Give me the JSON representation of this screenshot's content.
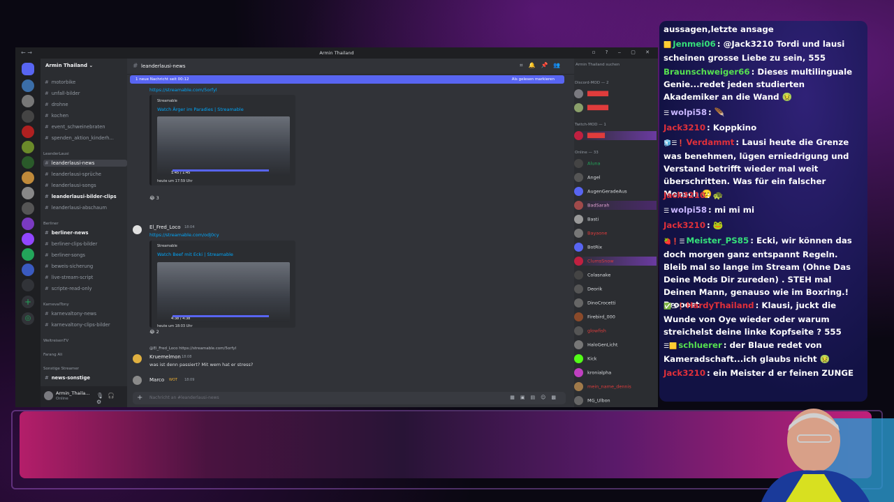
{
  "window": {
    "title": "Armin Thailand",
    "nav": "← →",
    "controls": "▫ ? ‒ ▢ ✕"
  },
  "guild": {
    "name": "Armin Thailand ⌄"
  },
  "channels": [
    {
      "label": "motorbike"
    },
    {
      "label": "unfall-bilder"
    },
    {
      "label": "drohne"
    },
    {
      "label": "kochen"
    },
    {
      "label": "event_schweinebraten"
    },
    {
      "label": "spenden_aktion_kinderh..."
    },
    {
      "label": "leanderlausi-news"
    },
    {
      "label": "leanderlausi-sprüche"
    },
    {
      "label": "leanderlausi-songs"
    },
    {
      "label": "leanderlausi-bilder-clips"
    },
    {
      "label": "leanderlausi-abschaum"
    },
    {
      "label": "berliner-news"
    },
    {
      "label": "berliner-clips-bilder"
    },
    {
      "label": "berliner-songs"
    },
    {
      "label": "beweis-sicherung"
    },
    {
      "label": "live-stream-script"
    },
    {
      "label": "scripte-read-only"
    },
    {
      "label": "karnevaltony-news"
    },
    {
      "label": "karnevaltony-clips-bilder"
    },
    {
      "label": "news-sonstige"
    }
  ],
  "categories": {
    "leanderlausi": "LeanderLausi",
    "berliner": "Berliner",
    "karneval": "KarnevalTony",
    "weltreisen": "WeltreisenTV",
    "farang": "Farang Ali",
    "sonstige": "Sonstige Streamer"
  },
  "user_panel": {
    "name": "Armin_Thaila...",
    "status": "Online"
  },
  "chat": {
    "channel": "leanderlausi-news",
    "new_message_text": "1 neue Nachricht seit 00:12",
    "mark_read": "Als gelesen markieren",
    "search_placeholder": "Armin Thailand suchen",
    "composer_placeholder": "Nachricht an #leanderlausi-news",
    "messages": [
      {
        "link": "https://streamable.com/5orfyl",
        "provider": "Streamable",
        "embed_title": "Watch Ärger im Paradies | Streamable",
        "time": "1:45 / 1:45",
        "footer": "heute um 17:59 Uhr",
        "reaction_count": "3"
      },
      {
        "author": "El_Fred_Loco",
        "timestamp": "18:04",
        "link": "https://streamable.com/odj0cy",
        "provider": "Streamable",
        "embed_title": "Watch Beef mit Ecki | Streamable",
        "time": "4:38 / 4:38",
        "footer": "heute um 18:03 Uhr",
        "reaction_count": "2"
      },
      {
        "reply": "@El_Fred_Loco https://streamable.com/5orfyl",
        "author": "Kruemelmon",
        "timestamp": "18:08",
        "text": "was ist denn passiert? Mit wem hat er stress?"
      },
      {
        "author": "Marco",
        "badge": "WOT",
        "timestamp": "18:09"
      }
    ]
  },
  "members": {
    "cat_mod": "Discord-MOD — 2",
    "cat_twitch": "Twitch-MOD — 1",
    "cat_online": "Online — 33",
    "list": [
      "Aluna",
      "Angel",
      "AugenGeradeAus",
      "BadSarah",
      "Basti",
      "Bayaone",
      "BotRix",
      "ClumsSnow",
      "Colasnake",
      "Deorik",
      "DinoCrocetti",
      "Firebird_000",
      "glowfish",
      "HaloGenLicht",
      "Kick",
      "kronialpha",
      "mein_name_dennis",
      "MG_Ulbon"
    ],
    "sub": {
      "BadSarah": "World of Warcraft",
      "Basti": "Arena Reforger",
      "Kick": "Sent 3232 notifications today. Off..."
    }
  },
  "twitch_chat": [
    {
      "name": "",
      "text": "aussagen,letzte ansage",
      "color": "#ffffff"
    },
    {
      "badges": "🟨",
      "name": "Jenmei06",
      "text": ": @Jack3210 Tordi und lausi scheinen grosse Liebe zu sein, 555",
      "color": "#36e07a"
    },
    {
      "name": "Braunschweiger66",
      "text": ": Dieses multilinguale Genie...redet jeden studierten Akademiker an die Wand 🤢",
      "color": "#56e050"
    },
    {
      "badges": "☰",
      "name": "wolpi58",
      "text": ": 🪶",
      "color": "#c9b7ff"
    },
    {
      "name": "Jack3210",
      "text": ": Koppkino",
      "color": "#e0303a"
    },
    {
      "badges": "🧊☰❗",
      "name": "Verdammt",
      "text": ": Lausi heute die Grenze was benehmen, lügen erniedrigung und Verstand betrifft wieder mal weit überschritten. Was für ein falscher Mensch 🫤",
      "color": "#e0303a"
    },
    {
      "name": "Jack3210",
      "text": ": 🐢",
      "color": "#e0303a"
    },
    {
      "badges": "☰",
      "name": "wolpi58",
      "text": ": mi mi mi",
      "color": "#c9b7ff"
    },
    {
      "name": "Jack3210",
      "text": ": 🐸",
      "color": "#e0303a"
    },
    {
      "badges": "🍓❗☰",
      "name": "Meister_PS85",
      "text": ": Ecki, wir können das doch morgen ganz entspannt Regeln. Bleib mal so lange im Stream (Ohne Das Deine Mods Dir zureden) . STEH mal Deinen Mann, genauso wie im Boxring.! Prooost",
      "color": "#36e07a"
    },
    {
      "badges": "✅☰❗",
      "name": "HardyThailand",
      "text": ": Klausi, juckt die Wunde von Oye wieder oder warum streichelst deine linke Kopfseite ? 555",
      "color": "#e0303a"
    },
    {
      "badges": "☰🟨",
      "name": "schluerer",
      "text": ": der Blaue redet von Kameradschaft...ich glaubs nicht 🤢",
      "color": "#56e050"
    },
    {
      "name": "Jack3210",
      "text": ": ein Meister d er feinen ZUNGE",
      "color": "#e0303a"
    }
  ]
}
